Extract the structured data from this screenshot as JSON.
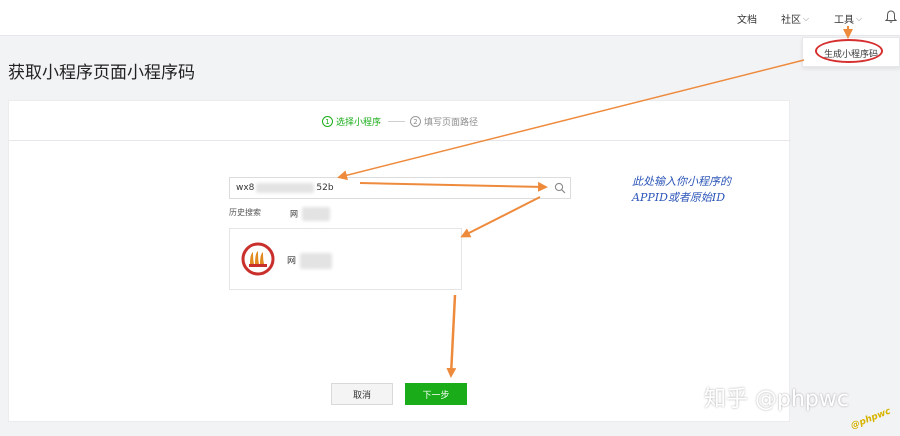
{
  "topnav": {
    "docs": "文档",
    "community": "社区",
    "tools": "工具"
  },
  "tools_menu": {
    "generate_code": "生成小程序码"
  },
  "page": {
    "title": "获取小程序页面小程序码"
  },
  "steps": [
    {
      "num": "1",
      "label": "选择小程序"
    },
    {
      "num": "2",
      "label": "填写页面路径"
    }
  ],
  "search": {
    "value_prefix": "wx8",
    "value_suffix": "52b"
  },
  "history": {
    "label": "历史搜索",
    "item": "网"
  },
  "result": {
    "name": "网"
  },
  "buttons": {
    "cancel": "取消",
    "next": "下一步"
  },
  "annotation": {
    "line1": "此处输入你小程序的",
    "line2": "APPID或者原始ID"
  },
  "watermark": {
    "zhihu": "知乎 @phpwc",
    "corner": "@phpwc"
  },
  "colors": {
    "accent_green": "#1aad19",
    "arrow_orange": "#ee8a3c",
    "highlight_red": "#d62f2f",
    "annotation_blue": "#2d56b8"
  }
}
